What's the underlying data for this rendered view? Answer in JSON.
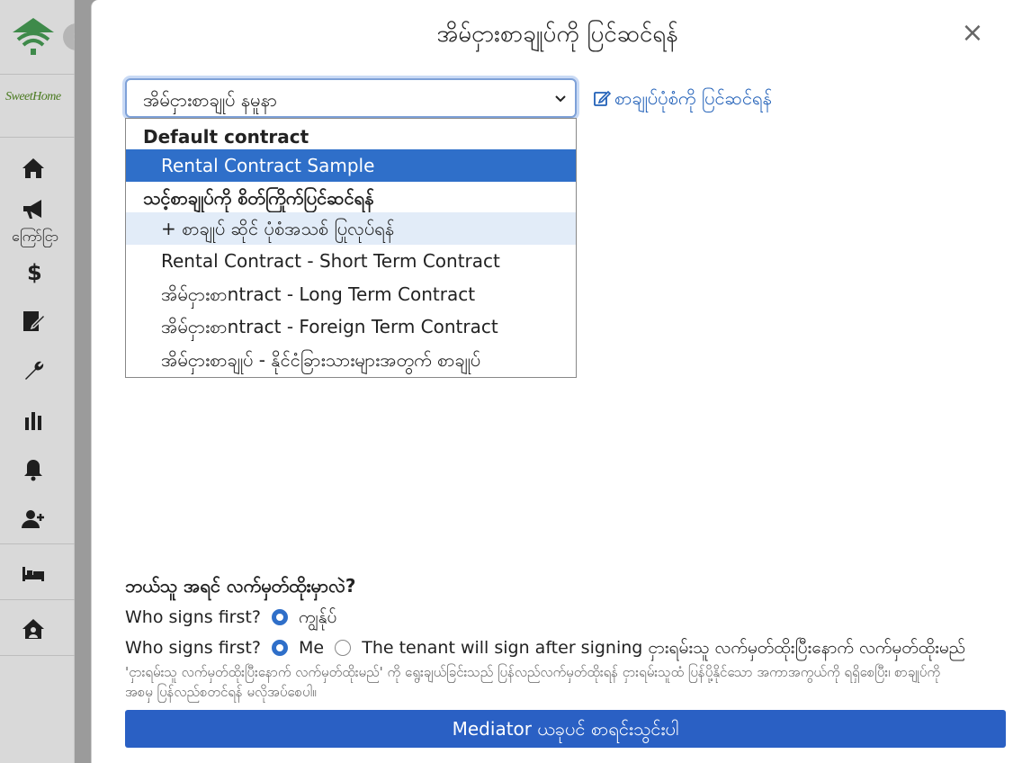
{
  "sidebar": {
    "brand": "SweetHome",
    "announcements_label": "ကြော်ငြာ"
  },
  "modal": {
    "title": "အိမ်ငှားစာချုပ်ကို ပြင်ဆင်ရန်",
    "close_symbol": "×"
  },
  "contract_select": {
    "selected_value": "အိမ်ငှားစာချုပ် နမူနာ"
  },
  "edit_link": "စာချုပ်ပုံစံကို ပြင်ဆင်ရန်",
  "dropdown": {
    "group_default": "Default contract",
    "option_sample": "Rental Contract Sample",
    "group_custom": "သင့်စာချုပ်ကို စိတ်ကြိုက်ပြင်ဆင်ရန်",
    "option_new": "+ စာချုပ် ဆိုင် ပုံစံအသစ် ပြုလုပ်ရန်",
    "option_short": "Rental Contract - Short Term Contract",
    "option_long": "အိမ်ငှားစာntract - Long Term Contract",
    "option_foreign": "အိမ်ငှားစာntract - Foreign Term Contract",
    "option_foreigners": "အိမ်ငှားစာချုပ် - နိုင်ငံခြားသားများအတွက် စာချုပ်"
  },
  "signing": {
    "question": "ဘယ်သူ အရင် လက်မှတ်ထိုးမှာလဲ?",
    "row1_label": "Who signs first?",
    "row1_option": "ကျွန်ုပ်",
    "row2_label": "Who signs first?",
    "row2_option_me": "Me",
    "row2_option_tenant": "The tenant will sign after signing ငှားရမ်းသူ လက်မှတ်ထိုးပြီးနောက် လက်မှတ်ထိုးမည်",
    "hint": "'ငှားရမ်းသူ လက်မှတ်ထိုးပြီးနောက် လက်မှတ်ထိုးမည်' ကို ရွေးချယ်ခြင်းသည် ပြန်လည်လက်မှတ်ထိုးရန် ငှားရမ်းသူထံ ပြန်ပို့နိုင်သော အကာအကွယ်ကို ရရှိစေပြီး၊ စာချုပ်ကို အစမှ ပြန်လည်စတင်ရန် မလိုအပ်စေပါ။"
  },
  "submit_button": "Mediator ယခုပင် စာရင်းသွင်းပါ",
  "colors": {
    "accent": "#2f6fc9",
    "button": "#2a60c4",
    "link": "#2160b8"
  }
}
